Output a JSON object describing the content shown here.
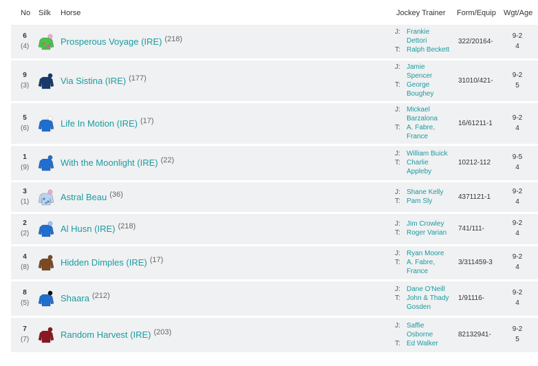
{
  "header": {
    "no": "No",
    "silk": "Silk",
    "horse": "Horse",
    "jockey_trainer": "Jockey Trainer",
    "form_equip": "Form/Equip",
    "wgt_age": "Wgt/Age"
  },
  "labels": {
    "jockey": "J:",
    "trainer": "T:"
  },
  "runners": [
    {
      "no": "6",
      "draw": "(4)",
      "horse": "Prosperous Voyage (IRE)",
      "rating": "(218)",
      "jockey": [
        "Frankie",
        "Dettori"
      ],
      "trainer": [
        "Ralph Beckett"
      ],
      "form": "322/20164-",
      "wgt": "9-2",
      "age": "4",
      "silk_body": "#4cc24c",
      "silk_cap": "#f4a6d7",
      "silk_spots": "#e0559a"
    },
    {
      "no": "9",
      "draw": "(3)",
      "horse": "Via Sistina (IRE)",
      "rating": "(177)",
      "jockey": [
        "Jamie",
        "Spencer"
      ],
      "trainer": [
        "George",
        "Boughey"
      ],
      "form": "31010/421-",
      "wgt": "9-2",
      "age": "5",
      "silk_body": "#163a6b",
      "silk_cap": "#163a6b",
      "silk_spots": ""
    },
    {
      "no": "5",
      "draw": "(6)",
      "horse": "Life In Motion (IRE)",
      "rating": "(17)",
      "jockey": [
        "Mickael",
        "Barzalona"
      ],
      "trainer": [
        "A. Fabre,",
        "France"
      ],
      "form": "16/61211-1",
      "wgt": "9-2",
      "age": "4",
      "silk_body": "#1f6fd1",
      "silk_cap": "#ffffff",
      "silk_spots": ""
    },
    {
      "no": "1",
      "draw": "(9)",
      "horse": "With the Moonlight (IRE)",
      "rating": "(22)",
      "jockey": [
        "William Buick"
      ],
      "trainer": [
        "Charlie",
        "Appleby"
      ],
      "form": "10212-112",
      "wgt": "9-5",
      "age": "4",
      "silk_body": "#1f6fd1",
      "silk_cap": "#1f6fd1",
      "silk_spots": ""
    },
    {
      "no": "3",
      "draw": "(1)",
      "horse": "Astral Beau",
      "rating": "(36)",
      "jockey": [
        "Shane Kelly"
      ],
      "trainer": [
        "Pam Sly"
      ],
      "form": "4371121-1",
      "wgt": "9-2",
      "age": "4",
      "silk_body": "#b8d4f0",
      "silk_cap": "#f4a6d7",
      "silk_spots": "#5a7fb8"
    },
    {
      "no": "2",
      "draw": "(2)",
      "horse": "Al Husn (IRE)",
      "rating": "(218)",
      "jockey": [
        "Jim Crowley"
      ],
      "trainer": [
        "Roger Varian"
      ],
      "form": "741/111-",
      "wgt": "9-2",
      "age": "4",
      "silk_body": "#1f6fd1",
      "silk_cap": "#9cc4f0",
      "silk_spots": ""
    },
    {
      "no": "4",
      "draw": "(8)",
      "horse": "Hidden Dimples (IRE)",
      "rating": "(17)",
      "jockey": [
        "Ryan Moore"
      ],
      "trainer": [
        "A. Fabre,",
        "France"
      ],
      "form": "3/311459-3",
      "wgt": "9-2",
      "age": "4",
      "silk_body": "#7a4a24",
      "silk_cap": "#7a4a24",
      "silk_spots": ""
    },
    {
      "no": "8",
      "draw": "(5)",
      "horse": "Shaara",
      "rating": "(212)",
      "jockey": [
        "Dane O'Neill"
      ],
      "trainer": [
        "John & Thady",
        "Gosden"
      ],
      "form": "1/91116-",
      "wgt": "9-2",
      "age": "4",
      "silk_body": "#1f6fd1",
      "silk_cap": "#111111",
      "silk_spots": ""
    },
    {
      "no": "7",
      "draw": "(7)",
      "horse": "Random Harvest (IRE)",
      "rating": "(203)",
      "jockey": [
        "Saffie",
        "Osborne"
      ],
      "trainer": [
        "Ed Walker"
      ],
      "form": "82132941-",
      "wgt": "9-2",
      "age": "5",
      "silk_body": "#8a1820",
      "silk_cap": "#8a1820",
      "silk_spots": ""
    }
  ]
}
